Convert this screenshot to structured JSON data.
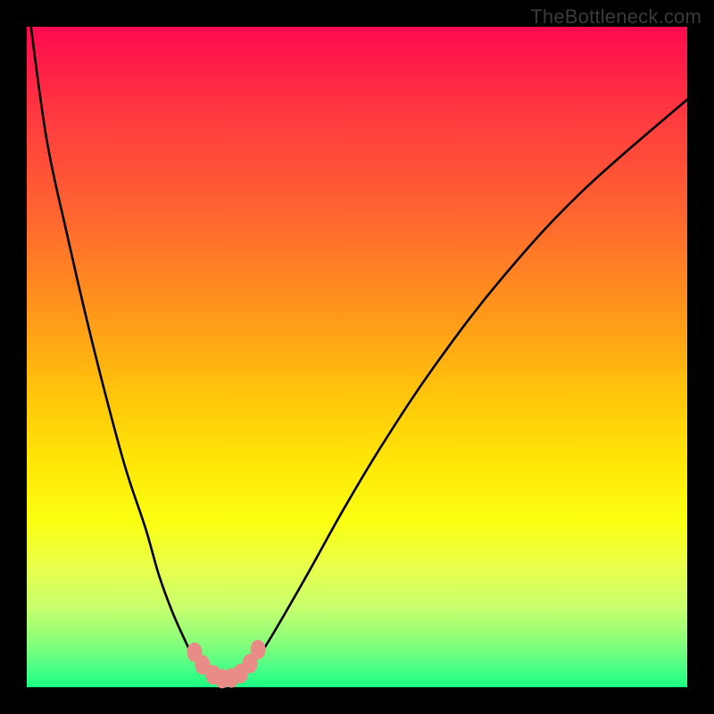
{
  "watermark": "TheBottleneck.com",
  "colors": {
    "frame": "#000000",
    "curve_stroke": "#000000",
    "marker_fill": "#e98b86",
    "gradient_top": "#ff0a4f",
    "gradient_bottom": "#1aff83"
  },
  "chart_data": {
    "type": "line",
    "title": "",
    "xlabel": "",
    "ylabel": "",
    "xlim": [
      0,
      100
    ],
    "ylim": [
      0,
      100
    ],
    "note": "Axes are unlabeled in the source image; x/y are normalized 0–100 (left→right, bottom→top) estimated from pixel positions.",
    "series": [
      {
        "name": "curve",
        "x": [
          0.5,
          3,
          6,
          9,
          12,
          15,
          18,
          20,
          22,
          24,
          25,
          26,
          27,
          28,
          29,
          30,
          31,
          32,
          33,
          34,
          36,
          39,
          43,
          48,
          54,
          62,
          72,
          84,
          100
        ],
        "y": [
          101,
          83,
          69,
          56,
          44,
          33,
          24,
          17,
          11.5,
          7,
          5,
          3.5,
          2.5,
          1.8,
          1.3,
          1.1,
          1.2,
          1.6,
          2.3,
          3.4,
          6,
          11,
          18,
          27,
          37,
          49,
          62,
          75,
          89
        ]
      }
    ],
    "markers": [
      {
        "x": 25.4,
        "y": 5.3
      },
      {
        "x": 26.6,
        "y": 3.4
      },
      {
        "x": 28.2,
        "y": 1.9
      },
      {
        "x": 29.6,
        "y": 1.3
      },
      {
        "x": 31.0,
        "y": 1.4
      },
      {
        "x": 32.4,
        "y": 2.1
      },
      {
        "x": 33.8,
        "y": 3.6
      },
      {
        "x": 35.0,
        "y": 5.7
      }
    ]
  }
}
